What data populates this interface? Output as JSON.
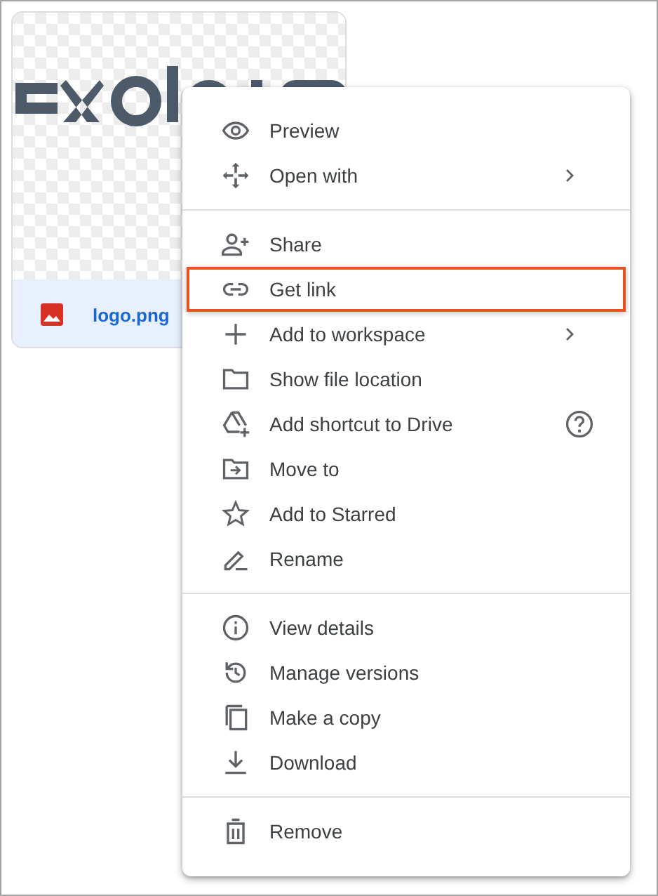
{
  "file_card": {
    "name": "logo.png"
  },
  "context_menu": {
    "groups": [
      {
        "items": [
          {
            "label": "Preview",
            "submenu": false,
            "help": false,
            "selected": false
          },
          {
            "label": "Open with",
            "submenu": true,
            "help": false,
            "selected": false
          }
        ]
      },
      {
        "items": [
          {
            "label": "Share",
            "submenu": false,
            "help": false,
            "selected": false
          },
          {
            "label": "Get link",
            "submenu": false,
            "help": false,
            "selected": true
          },
          {
            "label": "Add to workspace",
            "submenu": true,
            "help": false,
            "selected": false
          },
          {
            "label": "Show file location",
            "submenu": false,
            "help": false,
            "selected": false
          },
          {
            "label": "Add shortcut to Drive",
            "submenu": false,
            "help": true,
            "selected": false
          },
          {
            "label": "Move to",
            "submenu": false,
            "help": false,
            "selected": false
          },
          {
            "label": "Add to Starred",
            "submenu": false,
            "help": false,
            "selected": false
          },
          {
            "label": "Rename",
            "submenu": false,
            "help": false,
            "selected": false
          }
        ]
      },
      {
        "items": [
          {
            "label": "View details",
            "submenu": false,
            "help": false,
            "selected": false
          },
          {
            "label": "Manage versions",
            "submenu": false,
            "help": false,
            "selected": false
          },
          {
            "label": "Make a copy",
            "submenu": false,
            "help": false,
            "selected": false
          },
          {
            "label": "Download",
            "submenu": false,
            "help": false,
            "selected": false
          }
        ]
      },
      {
        "items": [
          {
            "label": "Remove",
            "submenu": false,
            "help": false,
            "selected": false
          }
        ]
      }
    ]
  }
}
